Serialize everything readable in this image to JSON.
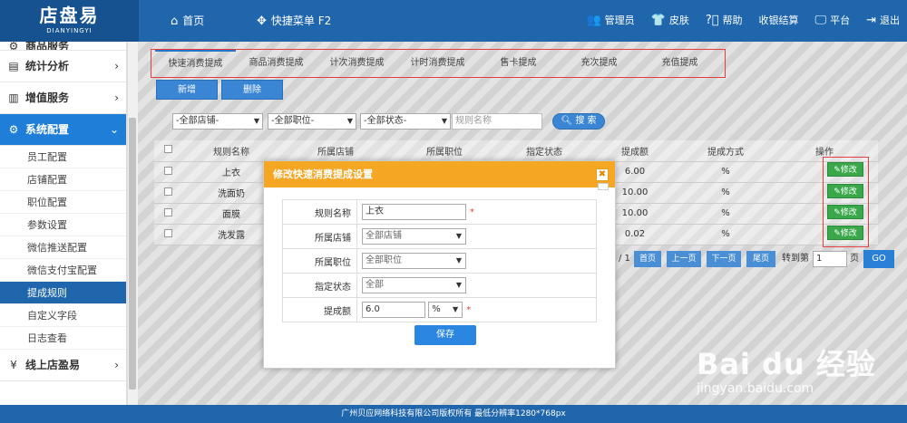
{
  "header": {
    "logo_main": "店盘易",
    "logo_sub": "DIANYINGYI",
    "home": "首页",
    "quick_menu": "快捷菜单 F2",
    "admin": "管理员",
    "skin": "皮肤",
    "help": "帮助",
    "checkout": "收银结算",
    "platform": "平台",
    "logout": "退出"
  },
  "sidebar": {
    "cut_group": "商品服务",
    "groups": [
      {
        "label": "统计分析"
      },
      {
        "label": "增值服务"
      },
      {
        "label": "系统配置"
      }
    ],
    "sub_items": [
      "员工配置",
      "店铺配置",
      "职位配置",
      "参数设置",
      "微信推送配置",
      "微信支付宝配置",
      "提成规则",
      "自定义字段",
      "日志查看"
    ],
    "last_group": "线上店盈易"
  },
  "tabs": [
    "快速消费提成",
    "商品消费提成",
    "计次消费提成",
    "计时消费提成",
    "售卡提成",
    "充次提成",
    "充值提成"
  ],
  "toolbar": {
    "add": "新增",
    "delete": "删除"
  },
  "filters": {
    "store": "-全部店铺-",
    "position": "-全部职位-",
    "status": "-全部状态-",
    "rule_placeholder": "规则名称",
    "search": "搜 索"
  },
  "table": {
    "headers": [
      "规则名称",
      "所属店铺",
      "所属职位",
      "指定状态",
      "提成额",
      "提成方式",
      "操作"
    ],
    "rows": [
      {
        "name": "上衣",
        "amount": "6.00",
        "method": "%",
        "op": "修改"
      },
      {
        "name": "洗面奶",
        "amount": "10.00",
        "method": "%",
        "op": "修改"
      },
      {
        "name": "面膜",
        "amount": "10.00",
        "method": "%",
        "op": "修改"
      },
      {
        "name": "洗发露",
        "amount": "0.02",
        "method": "%",
        "op": "修改"
      }
    ]
  },
  "pager": {
    "total": "/ 1",
    "first": "首页",
    "prev": "上一页",
    "next": "下一页",
    "last": "尾页",
    "goto": "转到第",
    "page_value": "1",
    "page_unit": "页",
    "go": "GO"
  },
  "modal": {
    "title": "修改快速消费提成设置",
    "close": "✖",
    "fields": {
      "rule_name_label": "规则名称",
      "rule_name_value": "上衣",
      "store_label": "所属店铺",
      "store_value": "全部店铺",
      "position_label": "所属职位",
      "position_value": "全部职位",
      "status_label": "指定状态",
      "status_value": "全部",
      "amount_label": "提成额",
      "amount_value": "6.0",
      "unit_value": "%"
    },
    "required_mark": "*",
    "save": "保存"
  },
  "footer": "广州贝应网络科技有限公司版权所有 最低分辨率1280*768px",
  "watermark": {
    "main": "Bai du 经验",
    "sub": "jingyan.baidu.com"
  },
  "colors": {
    "topbar": "#1f66ad",
    "accent": "#1f7fd8",
    "modal_header": "#f5a623",
    "edit_button": "#3aa84a",
    "highlight": "#e43d3d"
  }
}
